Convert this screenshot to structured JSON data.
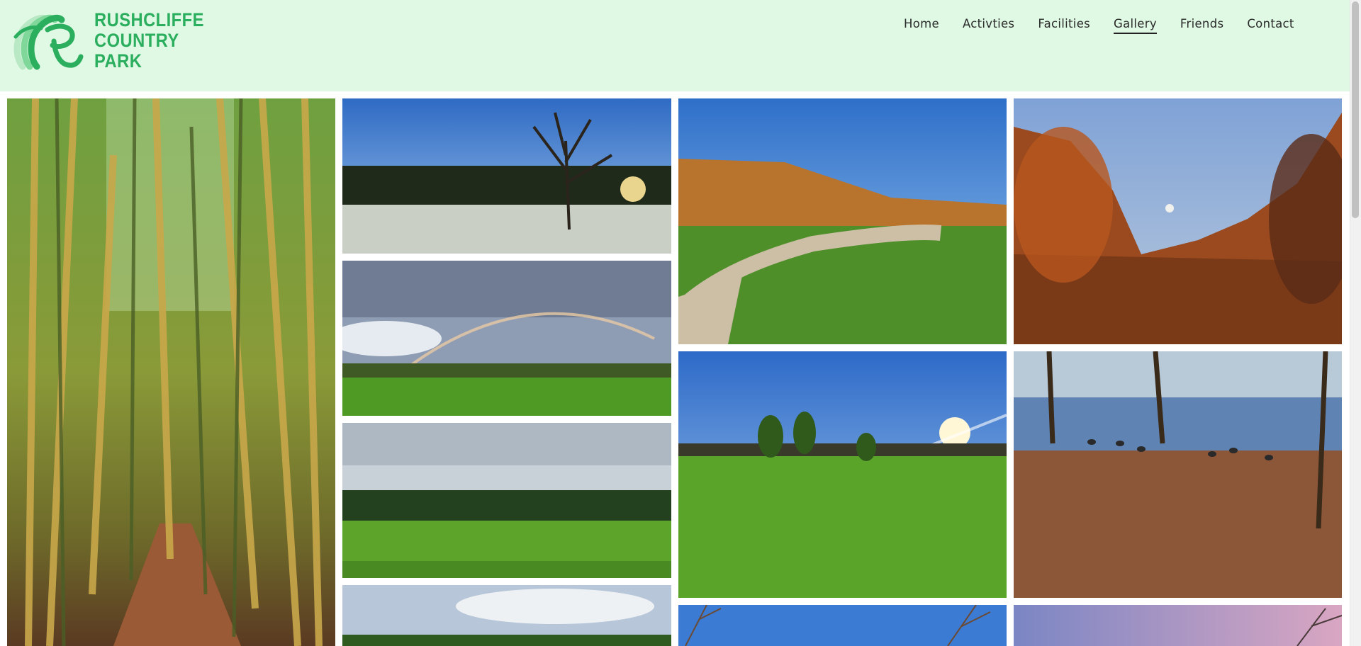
{
  "site": {
    "brand_line_1": "RUSHCLIFFE",
    "brand_line_2": "COUNTRY",
    "brand_line_3": "PARK",
    "brand_color": "#2bae5e",
    "header_bg": "#e0f9e4"
  },
  "nav": {
    "items": [
      {
        "label": "Home"
      },
      {
        "label": "Activties"
      },
      {
        "label": "Facilities"
      },
      {
        "label": "Gallery",
        "active": true
      },
      {
        "label": "Friends"
      },
      {
        "label": "Contact"
      }
    ]
  },
  "gallery": {
    "photos": [
      {
        "subject": "woodland path with tall trees"
      },
      {
        "subject": "bare tree with frosty field and low sun"
      },
      {
        "subject": "grass field with rainbow over trees"
      },
      {
        "subject": "green field with conifer tree line"
      },
      {
        "subject": "cloudy sky over field and trees"
      },
      {
        "subject": "gravel path through autumn larches"
      },
      {
        "subject": "sunny field with young trees and lens flare"
      },
      {
        "subject": "bare trees over sky"
      },
      {
        "subject": "autumn trees with moon in sky"
      },
      {
        "subject": "lake with ducks on autumn leaves"
      },
      {
        "subject": "pink evening sky with trees"
      }
    ]
  }
}
